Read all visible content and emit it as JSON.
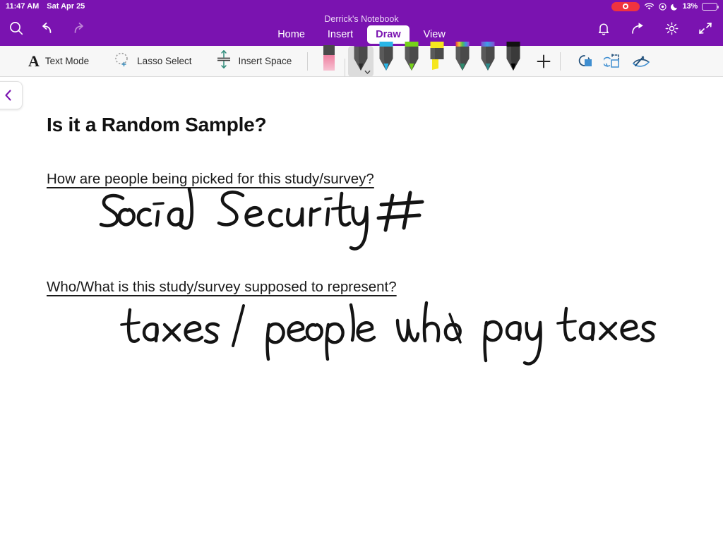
{
  "status_bar": {
    "time": "11:47 AM",
    "date": "Sat Apr 25",
    "recording_icon": "screen-recording-icon",
    "wifi_icon": "wifi-icon",
    "location_icon": "location-services-icon",
    "dnd_icon": "do-not-disturb-moon-icon",
    "battery_percent": "13%",
    "battery_level": 13,
    "background_color": "#7A13B0"
  },
  "ribbon": {
    "notebook_title": "Derrick's Notebook",
    "background_color": "#7A13B0",
    "left_icons": [
      {
        "name": "search-icon",
        "label": "Search"
      },
      {
        "name": "undo-icon",
        "label": "Undo"
      },
      {
        "name": "redo-icon",
        "label": "Redo"
      }
    ],
    "right_icons": [
      {
        "name": "notification-bell-icon",
        "label": "Notifications"
      },
      {
        "name": "share-icon",
        "label": "Share"
      },
      {
        "name": "gear-icon",
        "label": "Settings"
      },
      {
        "name": "collapse-ribbon-icon",
        "label": "Collapse Ribbon"
      }
    ],
    "tabs": [
      {
        "label": "Home",
        "active": false
      },
      {
        "label": "Insert",
        "active": false
      },
      {
        "label": "Draw",
        "active": true
      },
      {
        "label": "View",
        "active": false
      }
    ]
  },
  "toolbar": {
    "background_color": "#F7F7F7",
    "items": [
      {
        "icon": "text-mode-icon",
        "label": "Text Mode"
      },
      {
        "icon": "lasso-select-icon",
        "label": "Lasso Select"
      },
      {
        "icon": "insert-space-icon",
        "label": "Insert Space"
      }
    ],
    "pens": [
      {
        "name": "eraser",
        "type": "eraser",
        "body_color": "#F09AB4",
        "cap_color": "#4A4A4A",
        "selected": false
      },
      {
        "name": "pen-dark-gray",
        "type": "pen",
        "ink_color": "#3C3C3C",
        "cap_color": "#7A13B0",
        "selected": true
      },
      {
        "name": "pen-cyan",
        "type": "pen",
        "ink_color": "#29B6E8",
        "cap_color": "#29B6E8",
        "selected": false
      },
      {
        "name": "pen-green",
        "type": "pen",
        "ink_color": "#76D219",
        "cap_color": "#76D219",
        "selected": false
      },
      {
        "name": "highlighter-yellow",
        "type": "highlighter",
        "ink_color": "#F5E61E",
        "cap_color": "#F5E61E",
        "selected": false
      },
      {
        "name": "pen-rainbow",
        "type": "pen",
        "ink_color": "#2E8B6E",
        "cap_color": "rainbow",
        "selected": false
      },
      {
        "name": "pen-blue-gradient",
        "type": "pen",
        "ink_color": "#2E8B8B",
        "cap_color": "blue-gradient",
        "selected": false
      },
      {
        "name": "pen-black",
        "type": "pen",
        "ink_color": "#111111",
        "cap_color": "#111111",
        "selected": false
      }
    ],
    "add_pen_label": "+",
    "right_icons": [
      {
        "name": "ink-color-fill-icon",
        "label": "Color & Thickness"
      },
      {
        "name": "ink-to-shape-icon",
        "label": "Ink to Shape"
      },
      {
        "name": "ink-to-text-icon",
        "label": "Ink to Text"
      }
    ]
  },
  "page": {
    "back_button_icon": "chevron-left-icon",
    "title": "Is it a Random Sample?",
    "questions": [
      {
        "prompt": "How are people being picked for this study/survey?",
        "handwritten_answer": "Social Security #"
      },
      {
        "prompt": "Who/What is this study/survey supposed to represent?",
        "handwritten_answer": "taxes / people who pay taxes"
      }
    ]
  }
}
